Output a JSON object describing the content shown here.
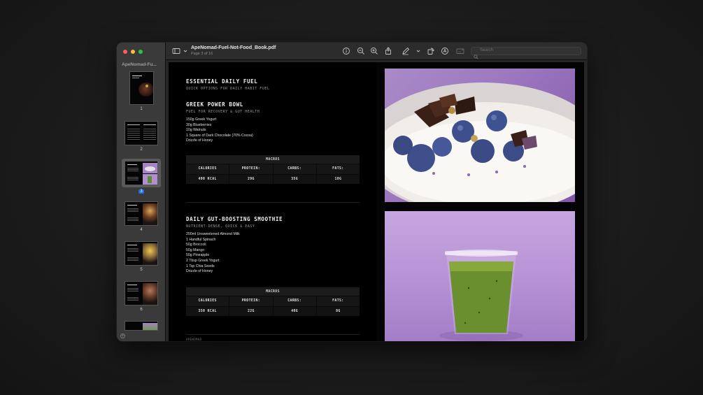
{
  "window": {
    "doc_title": "ApeNomad-Fuel-Not-Food_Book.pdf",
    "page_status": "Page 3 of 16",
    "search_placeholder": "Search"
  },
  "sidebar": {
    "title": "ApeNomad-Fu...",
    "pages": [
      "1",
      "2",
      "3",
      "4",
      "5",
      "6"
    ],
    "selected_page": "3"
  },
  "toolbar": {
    "icons": [
      "sidebar-icon",
      "chevron-down-icon",
      "info-icon",
      "zoom-out-icon",
      "zoom-in-icon",
      "share-icon",
      "markup-pen-icon",
      "chevron-down-icon",
      "rotate-icon",
      "annotate-icon",
      "form-fill-icon",
      "search-icon"
    ]
  },
  "page": {
    "section_title": "ESSENTIAL DAILY FUEL",
    "section_subtitle": "QUICK OPTIONS FOR DAILY HABIT FUEL",
    "recipes": [
      {
        "title": "GREEK POWER BOWL",
        "subtitle": "FUEL FOR RECOVERY & GUT HEALTH",
        "ingredients": [
          "150g Greek Yogurt",
          "30g Blueberries",
          "10g Walnuts",
          "1 Square of Dark Chocolate (70% Cocoa)",
          "Drizzle of Honey"
        ],
        "macros_label": "MACROS",
        "macro_headers": [
          "CALORIES",
          "PROTEIN:",
          "CARBS:",
          "FATS:"
        ],
        "macro_values": [
          "400 KCAL",
          "29G",
          "35G",
          "18G"
        ]
      },
      {
        "title": "DAILY GUT-BOOSTING SMOOTHIE",
        "subtitle": "NUTRIENT-DENSE, QUICK & EASY",
        "ingredients": [
          "200ml Unsweetened Almond Milk",
          "1 Handful Spinach",
          "50g Broccoli",
          "50g Mango",
          "50g Pineapple",
          "2 Tbsp Greek Yogurt",
          "1 Tsp Chia Seeds",
          "Drizzle of Honey"
        ],
        "macros_label": "MACROS",
        "macro_headers": [
          "CALORIES",
          "PROTEIN:",
          "CARBS:",
          "FATS:"
        ],
        "macro_values": [
          "350 KCAL",
          "22G",
          "40G",
          "8G"
        ]
      }
    ],
    "footer": "APENOMAD"
  },
  "colors": {
    "accent_selection": "#1a6ee8",
    "photo_purple": "#a77fc9"
  }
}
